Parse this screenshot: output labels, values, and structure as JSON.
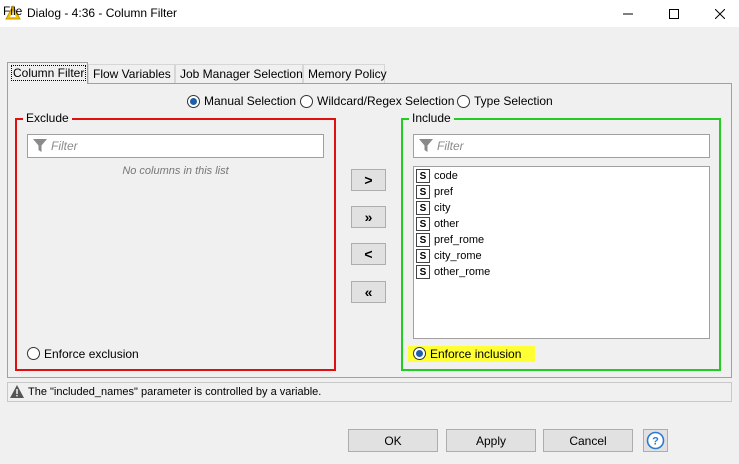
{
  "window": {
    "title": "Dialog - 4:36 - Column Filter",
    "minimize_icon": "minimize-icon",
    "maximize_icon": "maximize-icon",
    "close_icon": "close-icon"
  },
  "menu": {
    "file": "File"
  },
  "tabs": [
    {
      "label": "Column Filter",
      "active": true
    },
    {
      "label": "Flow Variables",
      "active": false
    },
    {
      "label": "Job Manager Selection",
      "active": false
    },
    {
      "label": "Memory Policy",
      "active": false
    }
  ],
  "mode": {
    "options": [
      "Manual Selection",
      "Wildcard/Regex Selection",
      "Type Selection"
    ],
    "selected": "Manual Selection"
  },
  "exclude": {
    "title": "Exclude",
    "filter_placeholder": "Filter",
    "empty_message": "No columns in this list",
    "enforce_label": "Enforce exclusion",
    "enforce_selected": false,
    "border_color": "#e01010"
  },
  "include": {
    "title": "Include",
    "filter_placeholder": "Filter",
    "type_badge": "S",
    "columns": [
      "code",
      "pref",
      "city",
      "other",
      "pref_rome",
      "city_rome",
      "other_rome"
    ],
    "enforce_label": "Enforce inclusion",
    "enforce_selected": true,
    "border_color": "#22cc22",
    "highlight_color": "#ffff33"
  },
  "move_buttons": {
    "add": ">",
    "add_all": "»",
    "remove": "<",
    "remove_all": "«"
  },
  "status": {
    "message": "The \"included_names\" parameter is controlled by a variable."
  },
  "buttons": {
    "ok": "OK",
    "apply": "Apply",
    "cancel": "Cancel",
    "help_icon": "help-icon"
  }
}
